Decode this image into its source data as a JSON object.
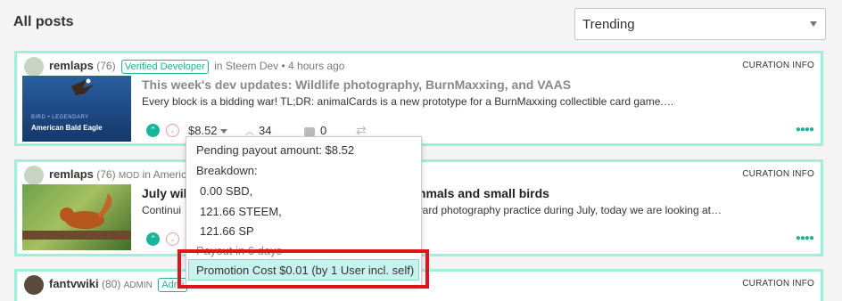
{
  "page": {
    "title": "All posts",
    "sort": {
      "selected": "Trending",
      "icon": "chevron-down-icon"
    }
  },
  "posts": [
    {
      "author": "remlaps",
      "reputation": "(76)",
      "badge": "Verified Developer",
      "community_text": "in Steem Dev • 4 hours ago",
      "curation_label": "CURATION INFO",
      "thumb_caption_small": "BIRD • LEGENDARY",
      "thumb_caption": "American Bald Eagle",
      "title": "This week's dev updates: Wildlife photography, BurnMaxxing, and VAAS",
      "summary": "Every block is a bidding war! TL;DR: animalCards is a new prototype for a BurnMaxxing collectible card game.…",
      "payout": "$8.52",
      "votes": "34",
      "comments": "0"
    },
    {
      "author": "remlaps",
      "reputation": "(76)",
      "role": "MOD",
      "community_text": "in America",
      "curation_label": "CURATION INFO",
      "title_left": "July wil",
      "title_right": "mmals and small birds",
      "summary_left": "Continui",
      "summary_right": "ward photography practice during July, today we are looking at…"
    },
    {
      "author": "fantvwiki",
      "reputation": "(80)",
      "role": "ADMIN",
      "badge": "Admi",
      "curation_label": "CURATION INFO"
    }
  ],
  "payout_popover": {
    "pending": "Pending payout amount: $8.52",
    "breakdown_label": "Breakdown:",
    "sbd": "0.00 SBD,",
    "steem": "121.66 STEEM,",
    "sp": "121.66 SP",
    "payout_in": "Payout in 6 days",
    "promotion": "Promotion Cost $0.01 (by 1 User incl. self)"
  },
  "colors": {
    "accent": "#1ab49a",
    "card_border": "#9df0dc",
    "highlight": "#e0141c",
    "promo_bg": "#c8f3ec"
  }
}
